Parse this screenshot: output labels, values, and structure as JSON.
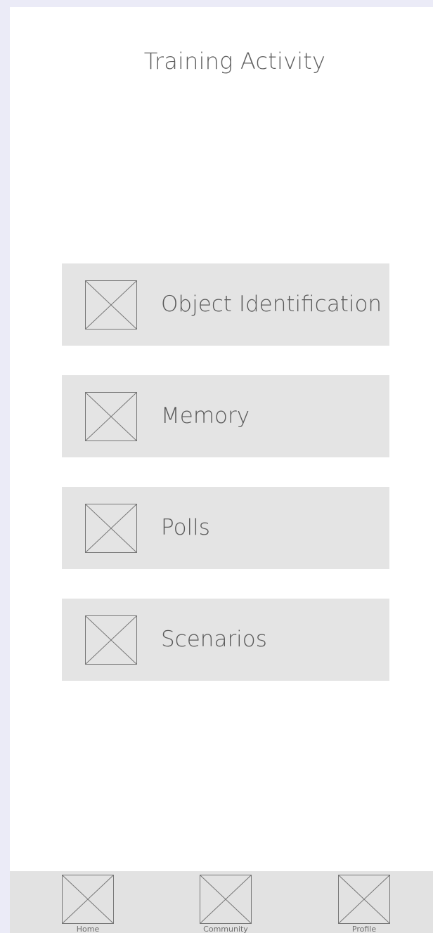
{
  "header": {
    "title": "Training Activity"
  },
  "activities": [
    {
      "label": "Object Identification",
      "icon": "placeholder-image-icon"
    },
    {
      "label": "Memory",
      "icon": "placeholder-image-icon"
    },
    {
      "label": "Polls",
      "icon": "placeholder-image-icon"
    },
    {
      "label": "Scenarios",
      "icon": "placeholder-image-icon"
    }
  ],
  "bottom_nav": {
    "items": [
      {
        "label": "Home",
        "icon": "home-placeholder-icon"
      },
      {
        "label": "Community",
        "icon": "community-placeholder-icon"
      },
      {
        "label": "Profile",
        "icon": "profile-placeholder-icon"
      }
    ]
  },
  "colors": {
    "page_background": "#ebebf7",
    "screen_background": "#ffffff",
    "card_background": "#e4e4e4",
    "nav_background": "#e2e2e2",
    "text": "#5a5a5a"
  }
}
